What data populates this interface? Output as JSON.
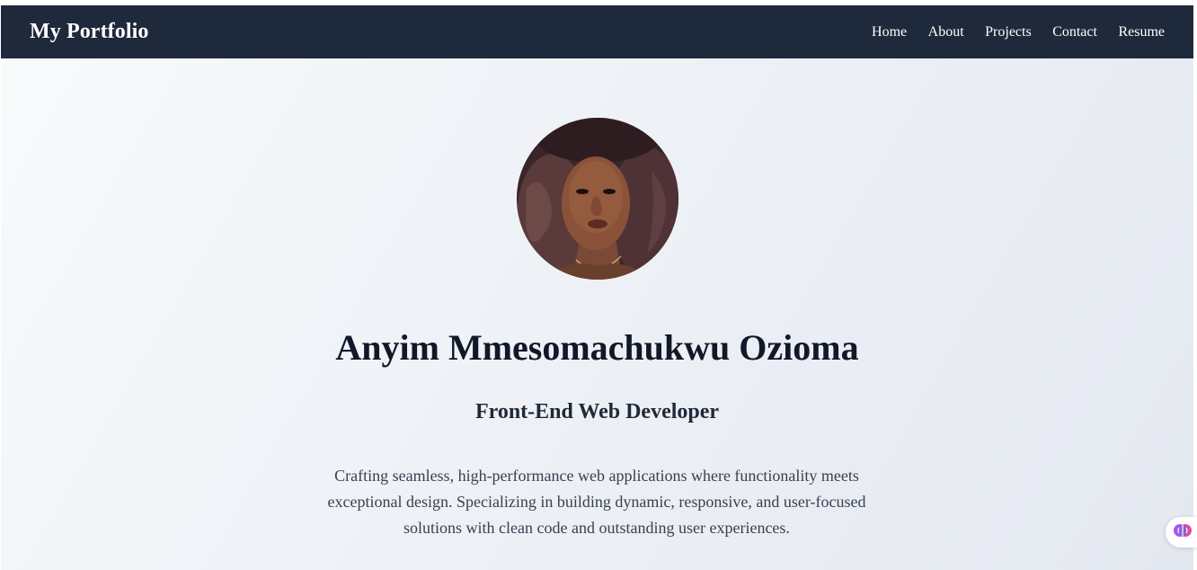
{
  "header": {
    "brand": "My Portfolio",
    "nav": [
      {
        "label": "Home"
      },
      {
        "label": "About"
      },
      {
        "label": "Projects"
      },
      {
        "label": "Contact"
      },
      {
        "label": "Resume"
      }
    ]
  },
  "hero": {
    "avatar_alt": "profile-photo",
    "name": "Anyim Mmesomachukwu Ozioma",
    "role": "Front-End Web Developer",
    "bio": "Crafting seamless, high-performance web applications where functionality meets exceptional design. Specializing in building dynamic, responsive, and user-focused solutions with clean code and outstanding user experiences."
  },
  "widget": {
    "icon": "brain-icon"
  },
  "colors": {
    "nav_bg": "#1e293b",
    "text_dark": "#111827",
    "text_body": "#374151"
  }
}
